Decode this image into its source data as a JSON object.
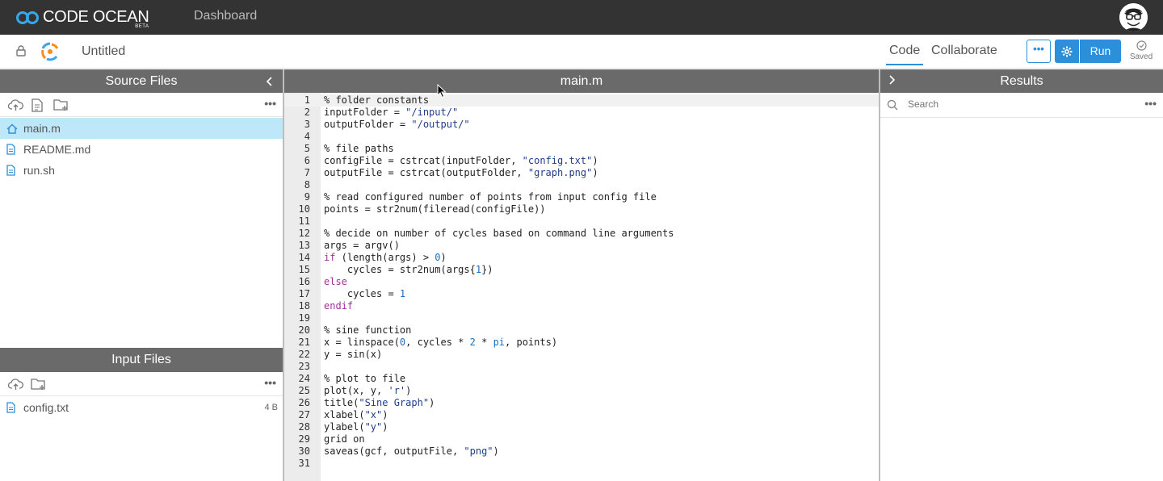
{
  "app": {
    "logo_text": "CODE OCEAN",
    "logo_badge": "BETA",
    "nav_dashboard": "Dashboard"
  },
  "capsule": {
    "title": "Untitled"
  },
  "tabs": {
    "code": "Code",
    "collaborate": "Collaborate"
  },
  "toolbar": {
    "more_label": "•••",
    "run_label": "Run",
    "status": "Saved"
  },
  "panels": {
    "source_title": "Source Files",
    "editor_title": "main.m",
    "results_title": "Results",
    "input_title": "Input Files"
  },
  "source_files": [
    {
      "name": "main.m",
      "icon": "home-icon",
      "active": true
    },
    {
      "name": "README.md",
      "icon": "file-icon"
    },
    {
      "name": "run.sh",
      "icon": "file-icon"
    }
  ],
  "input_files": [
    {
      "name": "config.txt",
      "size": "4 B",
      "icon": "file-icon"
    }
  ],
  "results": {
    "search_placeholder": "Search"
  },
  "code": {
    "current_line": 1,
    "lines": [
      "% folder constants",
      "inputFolder = \"/input/\"",
      "outputFolder = \"/output/\"",
      "",
      "% file paths",
      "configFile = cstrcat(inputFolder, \"config.txt\")",
      "outputFile = cstrcat(outputFolder, \"graph.png\")",
      "",
      "% read configured number of points from input config file",
      "points = str2num(fileread(configFile))",
      "",
      "% decide on number of cycles based on command line arguments",
      "args = argv()",
      "if (length(args) > 0)",
      "    cycles = str2num(args{1})",
      "else",
      "    cycles = 1",
      "endif",
      "",
      "% sine function",
      "x = linspace(0, cycles * 2 * pi, points)",
      "y = sin(x)",
      "",
      "% plot to file",
      "plot(x, y, 'r')",
      "title(\"Sine Graph\")",
      "xlabel(\"x\")",
      "ylabel(\"y\")",
      "grid on",
      "saveas(gcf, outputFile, \"png\")",
      ""
    ]
  },
  "colors": {
    "accent": "#2b90d9",
    "topbar": "#333333",
    "panel_header": "#6a6a6a",
    "active_file": "#bee7f9",
    "keyword": "#a0329b",
    "string": "#1f3d87",
    "number": "#1c6ebe"
  }
}
